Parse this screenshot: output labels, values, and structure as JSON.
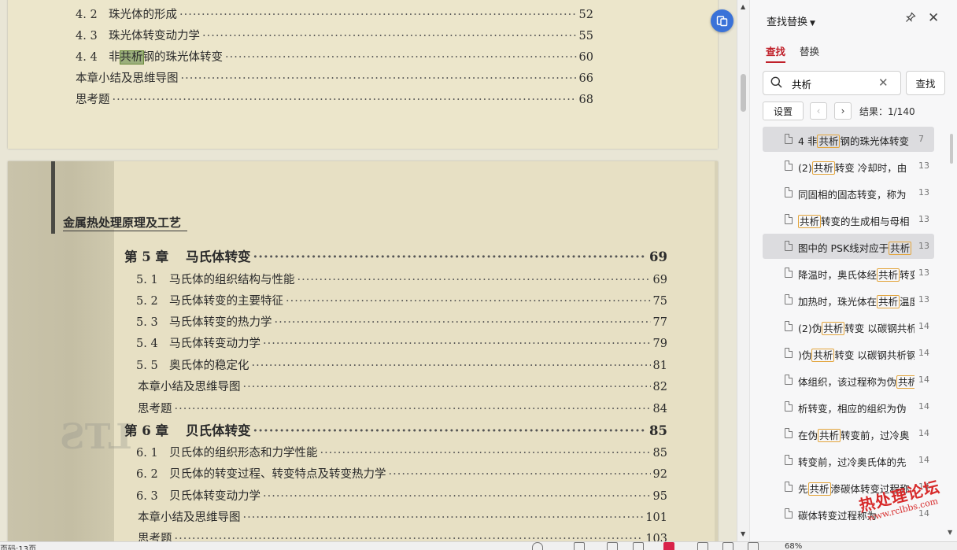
{
  "document": {
    "top_page_toc": [
      {
        "num": "4. 2",
        "title": "珠光体的形成",
        "page": "52"
      },
      {
        "num": "4. 3",
        "title": "珠光体转变动力学",
        "page": "55"
      },
      {
        "num": "4. 4",
        "title_before": "非",
        "title_highlight": "共析",
        "title_after": "钢的珠光体转变",
        "page": "60"
      },
      {
        "num": "",
        "title": "本章小结及思维导图",
        "page": "66"
      },
      {
        "num": "",
        "title": "思考题",
        "page": "68"
      }
    ],
    "book_title": "金属热处理原理及工艺",
    "ghost_text": "LTS",
    "bottom_page_toc": [
      {
        "num": "第 5 章",
        "title": "马氏体转变",
        "page": "69",
        "chapter": true
      },
      {
        "num": "5. 1",
        "title": "马氏体的组织结构与性能",
        "page": "69"
      },
      {
        "num": "5. 2",
        "title": "马氏体转变的主要特征",
        "page": "75"
      },
      {
        "num": "5. 3",
        "title": "马氏体转变的热力学",
        "page": "77"
      },
      {
        "num": "5. 4",
        "title": "马氏体转变动力学",
        "page": "79"
      },
      {
        "num": "5. 5",
        "title": "奥氏体的稳定化",
        "page": "81"
      },
      {
        "num": "",
        "title": "本章小结及思维导图",
        "page": "82"
      },
      {
        "num": "",
        "title": "思考题",
        "page": "84"
      },
      {
        "num": "第 6 章",
        "title": "贝氏体转变",
        "page": "85",
        "chapter": true
      },
      {
        "num": "6. 1",
        "title": "贝氏体的组织形态和力学性能",
        "page": "85"
      },
      {
        "num": "6. 2",
        "title": "贝氏体的转变过程、转变特点及转变热力学",
        "page": "92"
      },
      {
        "num": "6. 3",
        "title": "贝氏体转变动力学",
        "page": "95"
      },
      {
        "num": "",
        "title": "本章小结及思维导图",
        "page": "101"
      },
      {
        "num": "",
        "title": "思考题",
        "page": "103"
      }
    ]
  },
  "panel": {
    "title": "查找替换",
    "tabs": {
      "find": "查找",
      "replace": "替换"
    },
    "search_value": "共析",
    "find_button": "查找",
    "settings_button": "设置",
    "prev_icon": "‹",
    "next_icon": "›",
    "result_count": "结果：1/140",
    "results": [
      {
        "before": "4 非",
        "match": "共析",
        "after": "钢的珠光体转变",
        "page": "7",
        "active": true
      },
      {
        "before": "(2)",
        "match": "共析",
        "after": "转变 冷却时，由",
        "page": "13",
        "active": false
      },
      {
        "before": "同固相的固态转变，称为",
        "match": "",
        "after": "",
        "page": "13",
        "active": false
      },
      {
        "before": "",
        "match": "共析",
        "after": "转变的生成相与母相",
        "page": "13",
        "active": false
      },
      {
        "before": "图中的 PSK线对应于",
        "match": "共析",
        "after": "",
        "page": "13",
        "active": true
      },
      {
        "before": "降温时，奥氏体经",
        "match": "共析",
        "after": "转变",
        "page": "13",
        "active": false
      },
      {
        "before": "加热时，珠光体在",
        "match": "共析",
        "after": "温度",
        "page": "13",
        "active": false
      },
      {
        "before": "(2)伪",
        "match": "共析",
        "after": "转变 以碳钢共析",
        "page": "14",
        "active": false
      },
      {
        "before": ")伪",
        "match": "共析",
        "after": "转变 以碳钢共析钢",
        "page": "14",
        "active": false
      },
      {
        "before": "体组织，该过程称为伪",
        "match": "共析",
        "after": "",
        "page": "14",
        "active": false
      },
      {
        "before": "析转变，相应的组织为伪",
        "match": "",
        "after": "",
        "page": "14",
        "active": false
      },
      {
        "before": "在伪",
        "match": "共析",
        "after": "转变前，过冷奥",
        "page": "14",
        "active": false
      },
      {
        "before": "转变前，过冷奥氏体的先",
        "match": "",
        "after": "",
        "page": "14",
        "active": false
      },
      {
        "before": "先",
        "match": "共析",
        "after": "渗碳体转变过程称",
        "page": "14",
        "active": false
      },
      {
        "before": "碳体转变过程称为",
        "match": "",
        "after": "",
        "page": "14",
        "active": false
      }
    ]
  },
  "stamp": {
    "main": "热处理论坛",
    "url": "www.rclbbs.com"
  },
  "status": {
    "page_label": "页码:13页",
    "zoom": "68%"
  },
  "icons": {
    "float": "translate-doc-icon",
    "pin": "pin-icon",
    "close": "close-icon",
    "search": "search-icon",
    "clear": "clear-icon"
  },
  "colors": {
    "accent": "#c0202a",
    "match_border": "#e3a53c",
    "float_button": "#3a72d8",
    "stamp": "#d72a2a"
  }
}
